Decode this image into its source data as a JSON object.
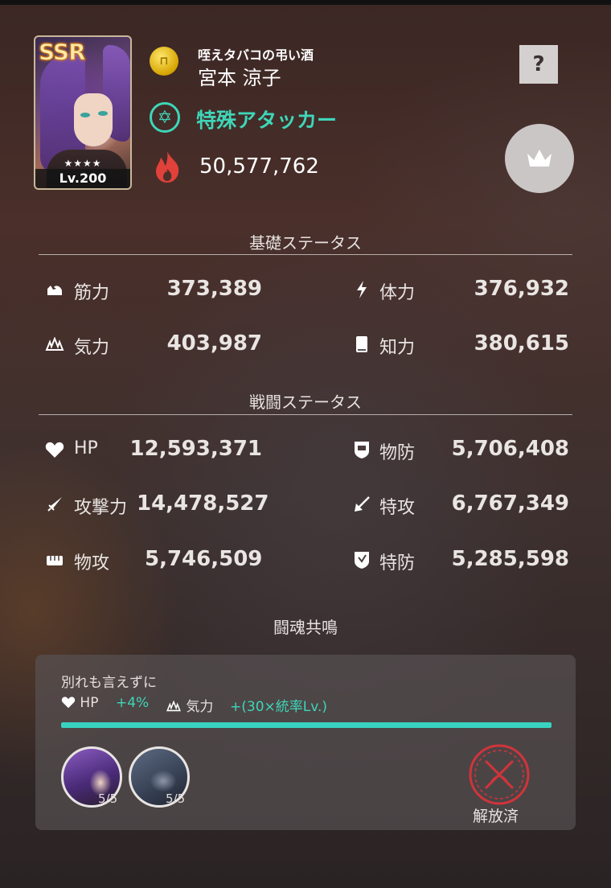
{
  "character": {
    "rarity": "SSR",
    "stars": "★★★★",
    "level": "Lv.200",
    "subtitle": "咥えタバコの弔い酒",
    "name": "宮本 涼子",
    "class": "特殊アタッカー",
    "power": "50,577,762",
    "coin_icon": "coin-icon",
    "class_icon": "hexagram-icon",
    "power_icon": "fire-icon"
  },
  "buttons": {
    "help": "?",
    "crown_icon": "crown-icon"
  },
  "base_status": {
    "title": "基礎ステータス",
    "items": [
      {
        "label": "筋力",
        "value": "373,389",
        "icon": "arm-icon"
      },
      {
        "label": "体力",
        "value": "376,932",
        "icon": "lightning-icon"
      },
      {
        "label": "気力",
        "value": "403,987",
        "icon": "aura-icon"
      },
      {
        "label": "知力",
        "value": "380,615",
        "icon": "book-icon"
      }
    ]
  },
  "battle_status": {
    "title": "戦闘ステータス",
    "items": [
      {
        "label": "HP",
        "value": "12,593,371",
        "icon": "heart-icon"
      },
      {
        "label": "物防",
        "value": "5,706,408",
        "icon": "shield-icon"
      },
      {
        "label": "攻撃力",
        "value": "14,478,527",
        "icon": "sword-icon"
      },
      {
        "label": "特攻",
        "value": "6,767,349",
        "icon": "arrow-icon"
      },
      {
        "label": "物攻",
        "value": "5,746,509",
        "icon": "fist-icon"
      },
      {
        "label": "特防",
        "value": "5,285,598",
        "icon": "magic-shield-icon"
      }
    ]
  },
  "resonance": {
    "title": "闘魂共鳴",
    "name": "別れも言えずに",
    "bonus1_label": "HP",
    "bonus1_value": "+4%",
    "bonus2_label": "気力",
    "bonus2_value": "+(30×統率Lv.)",
    "progress": 1.0,
    "members": [
      {
        "count": "5/5"
      },
      {
        "count": "5/5"
      }
    ],
    "unlock_label": "解放済"
  },
  "colors": {
    "accent": "#3ed6b8",
    "fire": "#e0413a",
    "coin": "#f2c418"
  }
}
